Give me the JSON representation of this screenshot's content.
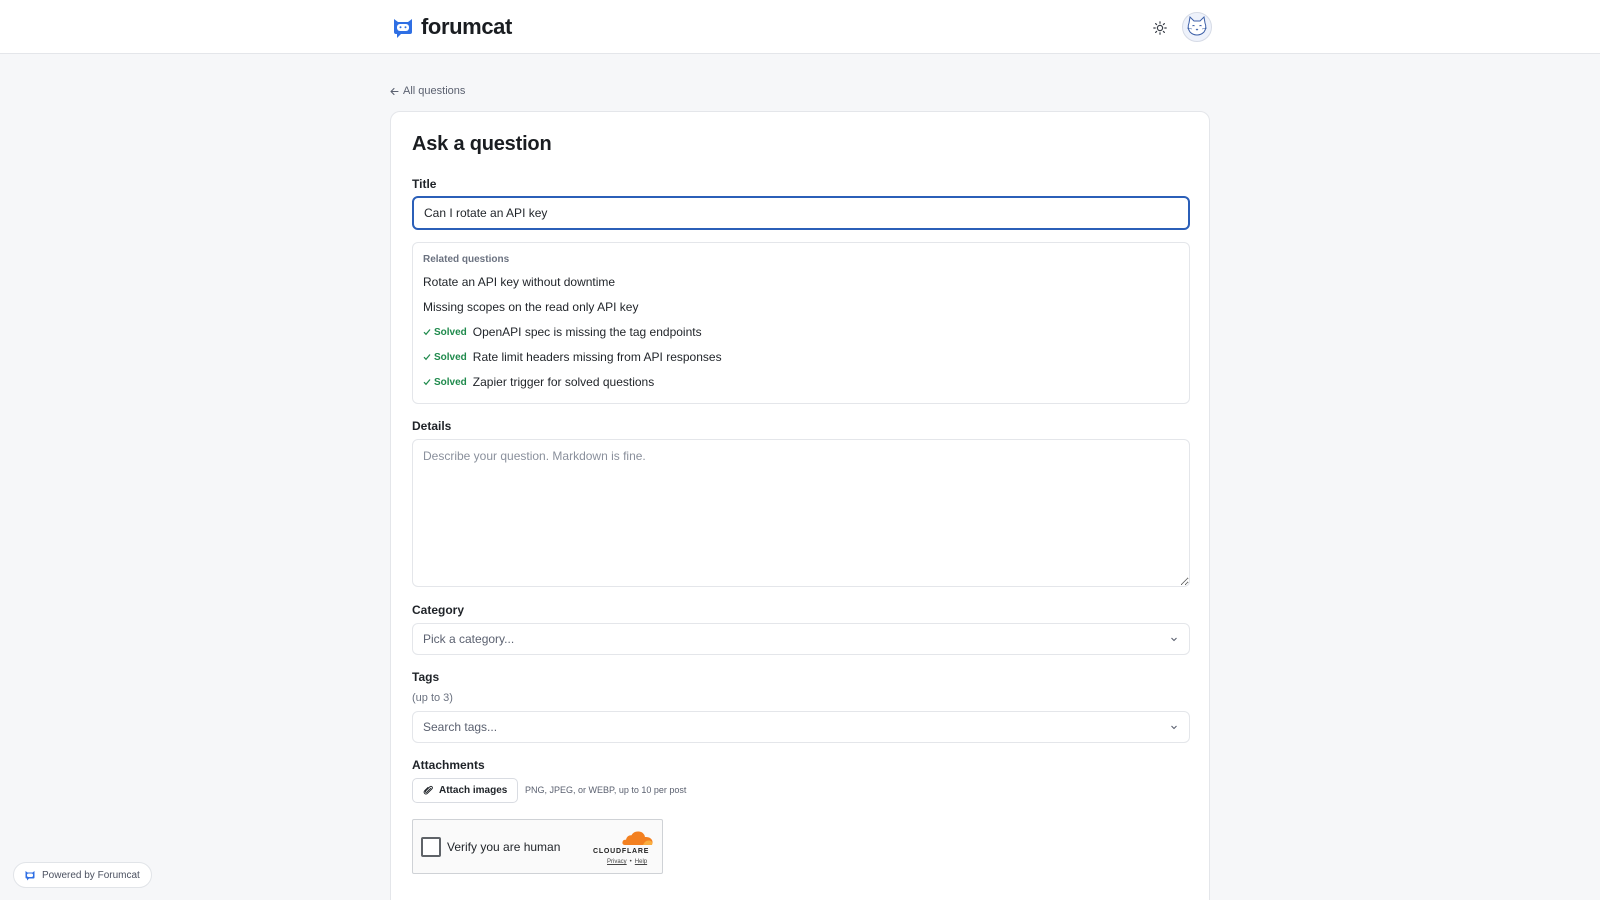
{
  "header": {
    "brand": "forumcat",
    "theme_toggle": "sun-icon",
    "avatar": "cat-avatar"
  },
  "nav": {
    "back_label": "All questions"
  },
  "form": {
    "page_title": "Ask a question",
    "title_label": "Title",
    "title_value": "Can I rotate an API key",
    "related": {
      "heading": "Related questions",
      "items": [
        {
          "solved": "",
          "text": "Rotate an API key without downtime"
        },
        {
          "solved": "",
          "text": "Missing scopes on the read only API key"
        },
        {
          "solved": "Solved",
          "text": "OpenAPI spec is missing the tag endpoints"
        },
        {
          "solved": "Solved",
          "text": "Rate limit headers missing from API responses"
        },
        {
          "solved": "Solved",
          "text": "Zapier trigger for solved questions"
        }
      ]
    },
    "details_label": "Details",
    "details_placeholder": "Describe your question. Markdown is fine.",
    "category_label": "Category",
    "category_placeholder": "Pick a category...",
    "tags_label": "Tags",
    "tags_hint": "(up to 3)",
    "tags_placeholder": "Search tags...",
    "attachments_label": "Attachments",
    "attach_button": "Attach images",
    "attach_hint": "PNG, JPEG, or WEBP, up to 10 per post"
  },
  "captcha": {
    "label": "Verify you are human",
    "brand": "CLOUDFLARE",
    "privacy": "Privacy",
    "separator": "•",
    "help": "Help"
  },
  "footer": {
    "powered_by": "Powered by Forumcat"
  },
  "colors": {
    "accent": "#2b5fb8",
    "brand_blue": "#2f6fe4",
    "solved_green": "#1f8a4c",
    "cloudflare_orange": "#f38020"
  }
}
